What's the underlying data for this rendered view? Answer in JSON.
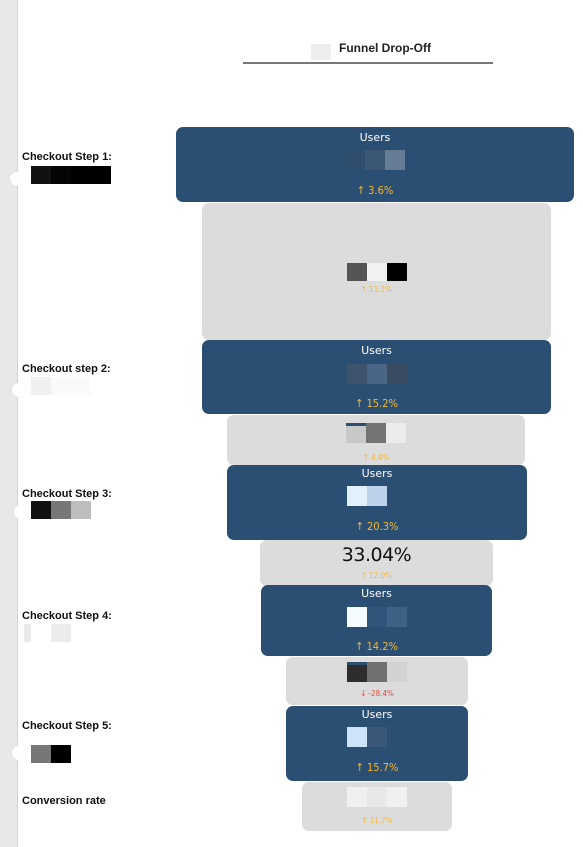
{
  "legend": {
    "label": "Funnel Drop-Off"
  },
  "steps": [
    {
      "label": "Checkout Step 1:"
    },
    {
      "label": "Checkout step 2:"
    },
    {
      "label": "Checkout Step 3:"
    },
    {
      "label": "Checkout Step 4:"
    },
    {
      "label": "Checkout Step 5:"
    },
    {
      "label": "Conversion rate"
    }
  ],
  "chart_data": {
    "type": "bar",
    "title": "Funnel Drop-Off",
    "categories": [
      "Checkout Step 1:",
      "Checkout step 2:",
      "Checkout Step 3:",
      "Checkout Step 4:",
      "Checkout Step 5:"
    ],
    "series": [
      {
        "name": "Users",
        "deltas": [
          "3.6%",
          "15.2%",
          "20.3%",
          "14.2%",
          "15.7%"
        ],
        "relative_width": [
          1.0,
          0.875,
          0.752,
          0.576,
          0.456
        ]
      }
    ],
    "drop_off": {
      "deltas": [
        "11.2%",
        "4.4%",
        "12.0%",
        "-28.4%",
        "11.7%"
      ],
      "values": [
        "",
        "",
        "33.04%",
        "",
        ""
      ],
      "relative_width": [
        0.875,
        0.747,
        0.581,
        0.456,
        0.376
      ]
    },
    "colors": {
      "users": "#2b4f72",
      "drop": "#dcdcdc",
      "positive": "#f5b833",
      "negative": "#e04b3c"
    },
    "series_titles": [
      "Users",
      "Users",
      "Users",
      "Users",
      "Users"
    ]
  },
  "bars": {
    "users_title": "Users",
    "d1": "3.6%",
    "d2": "15.2%",
    "d3": "20.3%",
    "d4": "14.2%",
    "d5": "15.7%",
    "drop1": "11.2%",
    "drop2": "4.4%",
    "drop3": "12.0%",
    "drop4": "-28.4%",
    "drop5": "11.7%",
    "big3": "33.04%"
  }
}
